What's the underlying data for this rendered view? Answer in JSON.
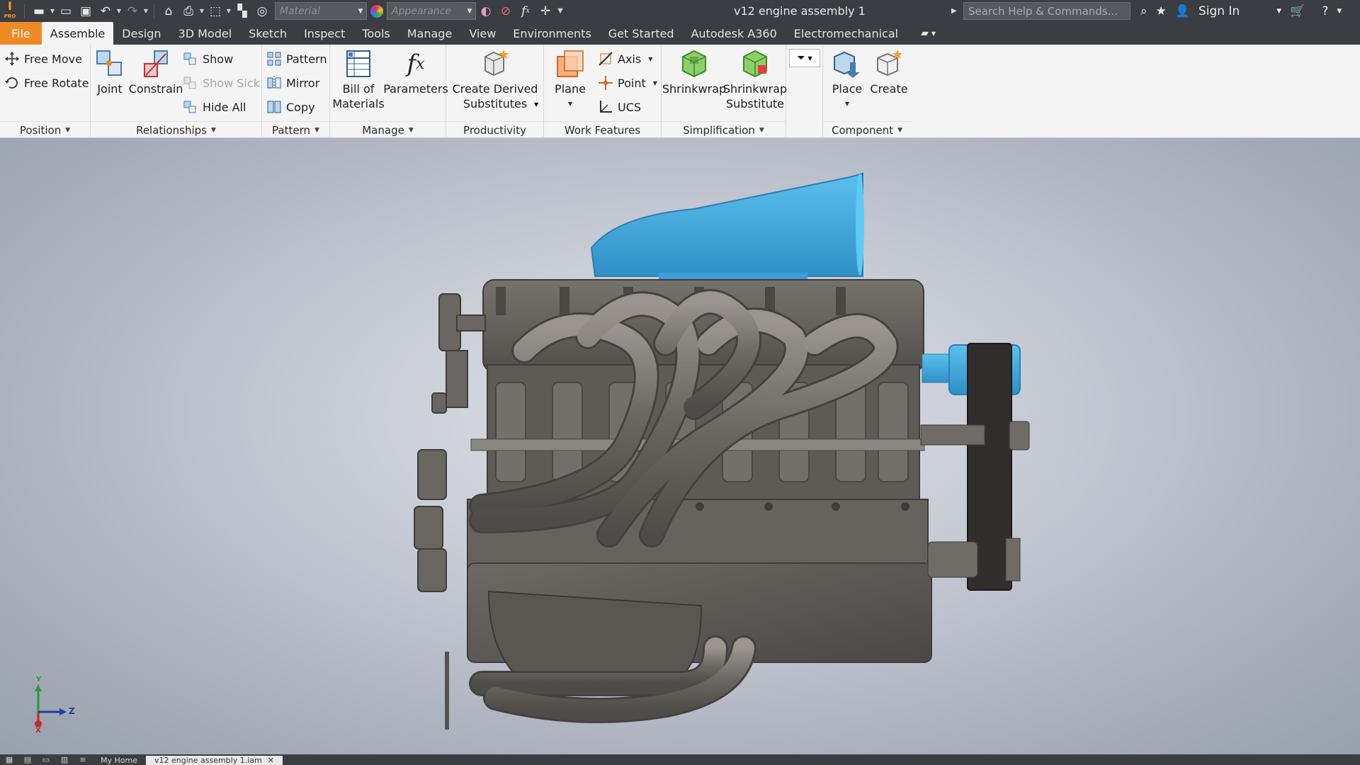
{
  "app": {
    "logo_text": "I",
    "logo_sub": "PRO"
  },
  "qat": {
    "material_placeholder": "Material",
    "appearance_placeholder": "Appearance"
  },
  "document": {
    "title": "v12 engine assembly 1"
  },
  "search": {
    "placeholder": "Search Help & Commands..."
  },
  "account": {
    "sign_in": "Sign In"
  },
  "tabs": [
    {
      "label": "File"
    },
    {
      "label": "Assemble"
    },
    {
      "label": "Design"
    },
    {
      "label": "3D Model"
    },
    {
      "label": "Sketch"
    },
    {
      "label": "Inspect"
    },
    {
      "label": "Tools"
    },
    {
      "label": "Manage"
    },
    {
      "label": "View"
    },
    {
      "label": "Environments"
    },
    {
      "label": "Get Started"
    },
    {
      "label": "Autodesk A360"
    },
    {
      "label": "Electromechanical"
    }
  ],
  "ribbon": {
    "position": {
      "title": "Position",
      "free_move": "Free Move",
      "free_rotate": "Free Rotate"
    },
    "relationships": {
      "title": "Relationships",
      "joint": "Joint",
      "constrain": "Constrain",
      "show": "Show",
      "show_sick": "Show Sick",
      "hide_all": "Hide All"
    },
    "pattern": {
      "title": "Pattern",
      "pattern": "Pattern",
      "mirror": "Mirror",
      "copy": "Copy"
    },
    "manage": {
      "title": "Manage",
      "bom_line1": "Bill of",
      "bom_line2": "Materials",
      "parameters": "Parameters"
    },
    "productivity": {
      "title": "Productivity",
      "line1": "Create Derived",
      "line2": "Substitutes"
    },
    "work_features": {
      "title": "Work Features",
      "plane": "Plane",
      "axis": "Axis",
      "point": "Point",
      "ucs": "UCS"
    },
    "simplification": {
      "title": "Simplification",
      "shrinkwrap": "Shrinkwrap",
      "sub_line1": "Shrinkwrap",
      "sub_line2": "Substitute"
    },
    "component": {
      "title": "Component",
      "place": "Place",
      "create": "Create"
    }
  },
  "triad": {
    "y_label": "Y",
    "z_label": "Z",
    "x_label": "X"
  },
  "bottom": {
    "doc_tab_home": "My Home",
    "doc_tab_active": "v12 engine assembly 1.iam"
  },
  "colors": {
    "accent": "#f08a24",
    "intake_blue": "#3fa6dc",
    "engine_gray": "#6e6b66",
    "chrome": "#3b3d42"
  }
}
